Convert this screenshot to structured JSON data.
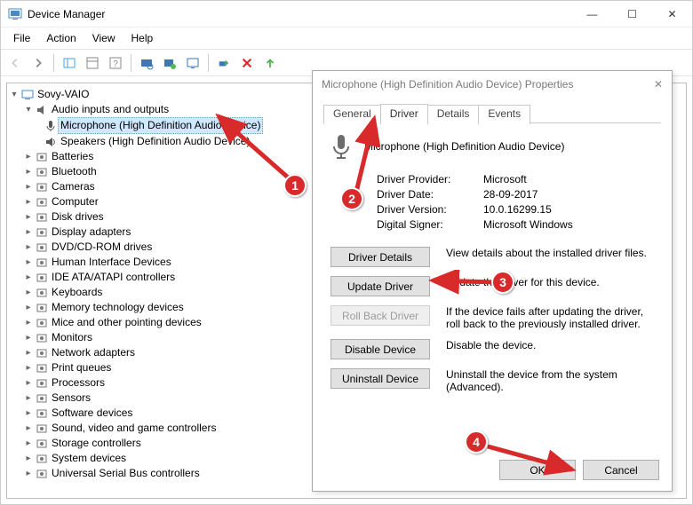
{
  "window": {
    "title": "Device Manager",
    "controls": {
      "minimize": "—",
      "maximize": "☐",
      "close": "✕"
    }
  },
  "menu": {
    "file": "File",
    "action": "Action",
    "view": "View",
    "help": "Help"
  },
  "tree": {
    "root": "Sovy-VAIO",
    "audio_label": "Audio inputs and outputs",
    "microphone_label": "Microphone (High Definition Audio Device)",
    "speakers_label": "Speakers (High Definition Audio Device)",
    "categories": [
      "Batteries",
      "Bluetooth",
      "Cameras",
      "Computer",
      "Disk drives",
      "Display adapters",
      "DVD/CD-ROM drives",
      "Human Interface Devices",
      "IDE ATA/ATAPI controllers",
      "Keyboards",
      "Memory technology devices",
      "Mice and other pointing devices",
      "Monitors",
      "Network adapters",
      "Print queues",
      "Processors",
      "Sensors",
      "Software devices",
      "Sound, video and game controllers",
      "Storage controllers",
      "System devices",
      "Universal Serial Bus controllers"
    ]
  },
  "dialog": {
    "title": "Microphone (High Definition Audio Device) Properties",
    "close_glyph": "✕",
    "tabs": {
      "general": "General",
      "driver": "Driver",
      "details": "Details",
      "events": "Events"
    },
    "device_name": "Microphone (High Definition Audio Device)",
    "provider_k": "Driver Provider:",
    "provider_v": "Microsoft",
    "date_k": "Driver Date:",
    "date_v": "28-09-2017",
    "version_k": "Driver Version:",
    "version_v": "10.0.16299.15",
    "signer_k": "Digital Signer:",
    "signer_v": "Microsoft Windows",
    "btn_details": "Driver Details",
    "btn_details_desc": "View details about the installed driver files.",
    "btn_update": "Update Driver",
    "btn_update_desc": "Update the driver for this device.",
    "btn_rollback": "Roll Back Driver",
    "btn_rollback_desc": "If the device fails after updating the driver, roll back to the previously installed driver.",
    "btn_disable": "Disable Device",
    "btn_disable_desc": "Disable the device.",
    "btn_uninstall": "Uninstall Device",
    "btn_uninstall_desc": "Uninstall the device from the system (Advanced).",
    "ok": "OK",
    "cancel": "Cancel"
  },
  "annotations": {
    "a1": "1",
    "a2": "2",
    "a3": "3",
    "a4": "4"
  }
}
